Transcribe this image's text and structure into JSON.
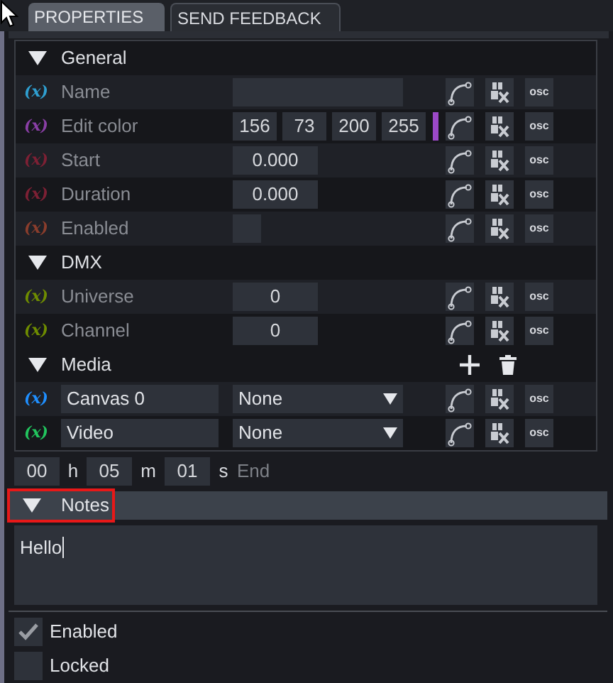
{
  "tabs": [
    {
      "label": "PROPERTIES",
      "selected": true
    },
    {
      "label": "SEND FEEDBACK",
      "selected": false
    }
  ],
  "sections": [
    {
      "title": "General",
      "expanded": true,
      "rows": [
        {
          "kind": "text",
          "symbol": "(x)",
          "color": "#2f9fd0",
          "label": "Name",
          "buttons": [
            "osc"
          ]
        },
        {
          "kind": "color",
          "symbol": "(x)",
          "color": "#8a3fa6",
          "label": "Edit color",
          "values": [
            "156",
            "73",
            "200",
            "255"
          ],
          "swatch": {
            "color": "#9c49c8"
          },
          "buttons": [
            "osc"
          ]
        },
        {
          "kind": "number",
          "symbol": "(x)",
          "color": "#7d2034",
          "label": "Start",
          "value": "0.000",
          "buttons": [
            "osc"
          ]
        },
        {
          "kind": "number",
          "symbol": "(x)",
          "color": "#7d2034",
          "label": "Duration",
          "value": "0.000",
          "buttons": [
            "osc"
          ]
        },
        {
          "kind": "checkbox",
          "symbol": "(x)",
          "color": "#8a3d2c",
          "label": "Enabled",
          "checked": false,
          "buttons": [
            "osc"
          ]
        }
      ]
    },
    {
      "title": "DMX",
      "expanded": true,
      "rows": [
        {
          "kind": "number",
          "symbol": "(x)",
          "color": "#6e8c00",
          "label": "Universe",
          "value": "0",
          "buttons": [
            "osc"
          ]
        },
        {
          "kind": "number",
          "symbol": "(x)",
          "color": "#6e8c00",
          "label": "Channel",
          "value": "0",
          "buttons": [
            "osc"
          ]
        }
      ]
    },
    {
      "title": "Media",
      "expanded": true,
      "has_add_remove": true,
      "rows": [
        {
          "kind": "media",
          "symbol": "(x)",
          "color": "#1f8fff",
          "name": "Canvas 0",
          "choice": "None",
          "buttons": [
            "osc"
          ]
        },
        {
          "kind": "media",
          "symbol": "(x)",
          "color": "#22c55e",
          "name": "Video",
          "choice": "None",
          "buttons": [
            "osc"
          ]
        }
      ]
    }
  ],
  "time": {
    "hours": "00",
    "h": "h",
    "minutes": "05",
    "m": "m",
    "seconds": "01",
    "s": "s",
    "end": "End"
  },
  "notes": {
    "title": "Notes",
    "expanded": true,
    "highlighted": true,
    "value": "Hello"
  },
  "flags": [
    {
      "label": "Enabled",
      "checked": true
    },
    {
      "label": "Locked",
      "checked": false
    }
  ]
}
